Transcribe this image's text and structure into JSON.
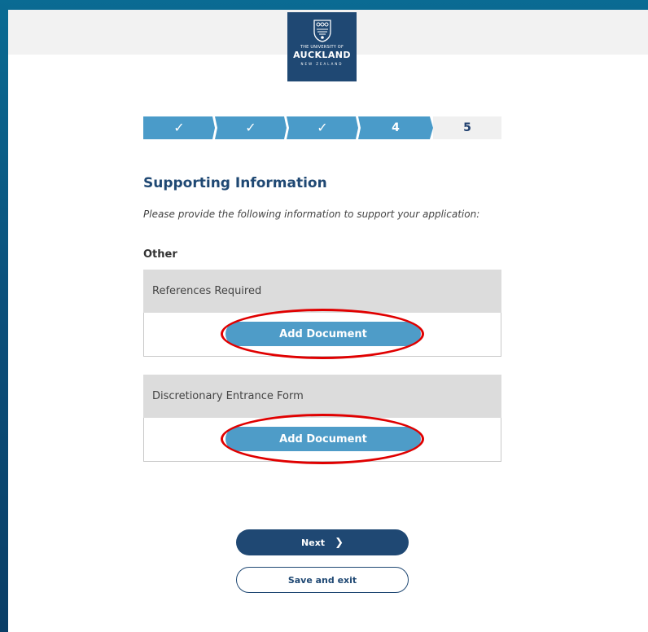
{
  "logo": {
    "line1": "THE UNIVERSITY OF",
    "line2": "AUCKLAND",
    "line3": "NEW ZEALAND"
  },
  "stepper": {
    "steps": [
      {
        "label": "✓",
        "state": "complete"
      },
      {
        "label": "✓",
        "state": "complete"
      },
      {
        "label": "✓",
        "state": "complete"
      },
      {
        "label": "4",
        "state": "current"
      },
      {
        "label": "5",
        "state": "upcoming"
      }
    ]
  },
  "main": {
    "title": "Supporting Information",
    "subtitle": "Please provide the following information to support your application:",
    "section_label": "Other",
    "documents": [
      {
        "heading": "References Required",
        "button_label": "Add Document"
      },
      {
        "heading": "Discretionary Entrance Form",
        "button_label": "Add Document"
      }
    ]
  },
  "footer": {
    "next_label": "Next",
    "next_icon": "chevron-right-icon",
    "save_label": "Save and exit"
  },
  "colors": {
    "brand_navy": "#1f4873",
    "step_blue": "#4a9bc9",
    "button_blue": "#4e9cc8",
    "annotation_red": "#e00000"
  }
}
